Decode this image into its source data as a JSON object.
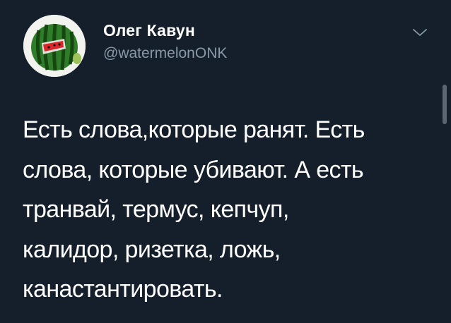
{
  "author": {
    "display_name": "Олег Кавун",
    "handle": "@watermelonONK",
    "avatar_icon": "watermelon-icon"
  },
  "menu": {
    "icon": "chevron-down-icon"
  },
  "tweet": {
    "lines": [
      "Есть слова,которые ранят. Есть",
      "слова, которые убивают. А есть",
      "транвай, термус, кепчуп,",
      "калидор, ризетка, ложь,",
      "канастантировать."
    ]
  },
  "colors": {
    "background": "#151f2b",
    "text_primary": "#ffffff",
    "text_secondary": "#8899a6"
  }
}
